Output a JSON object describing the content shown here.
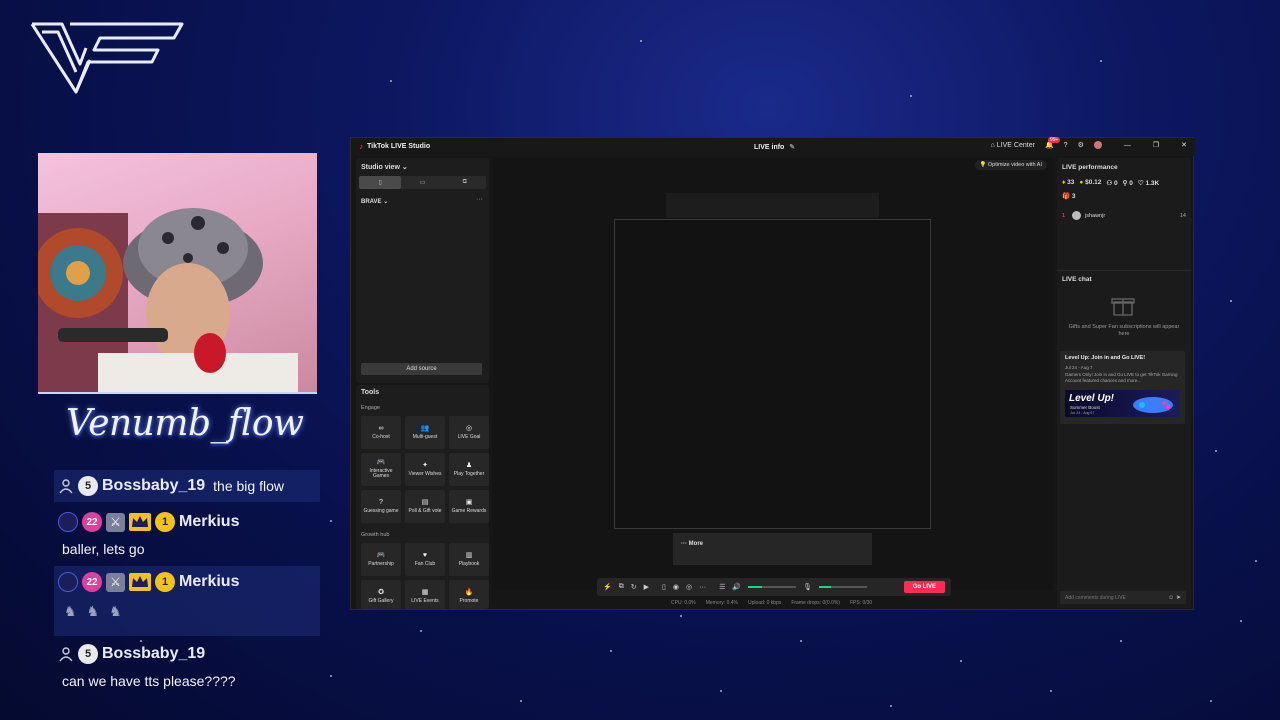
{
  "overlay": {
    "streamer_name": "Venumb_flow",
    "chat": [
      {
        "level": "5",
        "user": "Bossbaby_19",
        "message": "the big flow"
      },
      {
        "badge_level": "22",
        "gold_level": "1",
        "user": "Merkius",
        "message": "baller, lets go"
      },
      {
        "badge_level": "22",
        "gold_level": "1",
        "user": "Merkius",
        "message": ""
      },
      {
        "level": "5",
        "user": "Bossbaby_19",
        "message": "can we have tts please????"
      }
    ]
  },
  "studio": {
    "app_title": "TikTok LIVE Studio",
    "center_title": "LIVE info",
    "live_center": "LIVE Center",
    "notif_count": "99+",
    "optimize": "Optimize video with AI",
    "studio_view": "Studio view",
    "scene_name": "BRAVE",
    "add_source": "Add source",
    "tools_title": "Tools",
    "sections": {
      "engage": "Engage",
      "growth": "Growth hub"
    },
    "engage_tools": [
      {
        "label": "Co-host",
        "icon": "∞"
      },
      {
        "label": "Multi-guest",
        "icon": "👥"
      },
      {
        "label": "LIVE Goal",
        "icon": "◎"
      },
      {
        "label": "Interactive Games",
        "icon": "🎮"
      },
      {
        "label": "Viewer Wishes",
        "icon": "✦"
      },
      {
        "label": "Play Together",
        "icon": "♟"
      },
      {
        "label": "Guessing game",
        "icon": "?"
      },
      {
        "label": "Poll & Gift vote",
        "icon": "▤"
      },
      {
        "label": "Game Rewards",
        "icon": "▣"
      }
    ],
    "growth_tools": [
      {
        "label": "Partnership",
        "icon": "🎮"
      },
      {
        "label": "Fan Club",
        "icon": "♥"
      },
      {
        "label": "Playbook",
        "icon": "▥"
      },
      {
        "label": "Gift Gallery",
        "icon": "✪"
      },
      {
        "label": "LIVE Events",
        "icon": "▦"
      },
      {
        "label": "Promote",
        "icon": "🔥"
      }
    ],
    "more_label": "More",
    "go_live": "Go LIVE",
    "status": {
      "cpu": "CPU: 0.0%",
      "memory": "Memory: 0.4%",
      "upload": "Upload: 0 kbps",
      "frame_drops": "Frame drops: 0(0.0%)",
      "fps": "FPS: 0/30"
    },
    "volume_level": 0.3,
    "mic_level": 0.25,
    "right": {
      "perf_title": "LIVE performance",
      "stats": {
        "diamonds": "33",
        "money": "$0.12",
        "viewers": "0",
        "shares": "0",
        "likes": "1.3K"
      },
      "stat2": "3",
      "viewer": {
        "rank": "1",
        "name": "jshawnjr",
        "count": "14"
      },
      "chat_title": "LIVE chat",
      "gift_text": "Gifts and Super Fan subscriptions will appear here",
      "event": {
        "title": "Level Up: Join in and Go LIVE!",
        "date": "Jul 24 - Aug 7",
        "desc": "Gamers Only! Join in and Go LIVE to get TikTok Gaming Account featured chances and more...",
        "banner_title": "Level Up!",
        "banner_sub": "Summer Boost",
        "banner_dates": "Jul. 24 - Aug 07"
      },
      "comment_placeholder": "Add comments during LIVE"
    }
  },
  "colors": {
    "accent": "#fe2c55",
    "live_green": "#22d47b",
    "bg": "#0d1760"
  }
}
